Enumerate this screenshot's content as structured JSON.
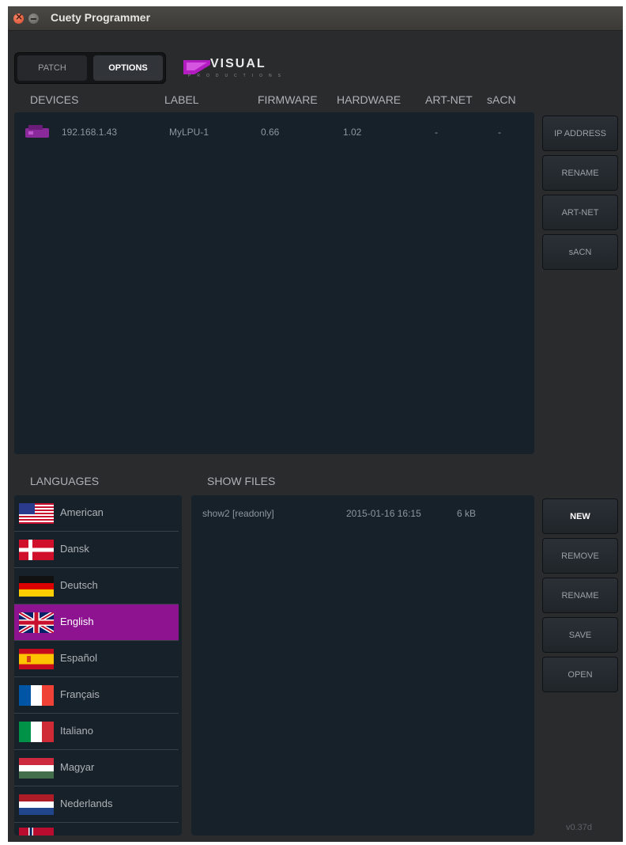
{
  "window": {
    "title": "Cuety Programmer"
  },
  "tabs": {
    "patch": "PATCH",
    "options": "OPTIONS"
  },
  "logo": {
    "word": "VISUAL",
    "sub": "PRODUCTIONS"
  },
  "devices": {
    "columns": [
      "DEVICES",
      "LABEL",
      "FIRMWARE",
      "HARDWARE",
      "ART-NET",
      "sACN"
    ],
    "rows": [
      {
        "device": "192.168.1.43",
        "label": "MyLPU-1",
        "firmware": "0.66",
        "hardware": "1.02",
        "artnet": "-",
        "sacn": "-"
      }
    ]
  },
  "device_actions": [
    "IP ADDRESS",
    "RENAME",
    "ART-NET",
    "sACN"
  ],
  "languages": {
    "header": "LANGUAGES",
    "items": [
      "American",
      "Dansk",
      "Deutsch",
      "English",
      "Español",
      "Français",
      "Italiano",
      "Magyar",
      "Nederlands"
    ],
    "selected": "English"
  },
  "showfiles": {
    "header": "SHOW FILES",
    "rows": [
      {
        "name": "show2 [readonly]",
        "date": "2015-01-16 16:15",
        "size": "6 kB"
      }
    ]
  },
  "show_actions": [
    "NEW",
    "REMOVE",
    "RENAME",
    "SAVE",
    "OPEN"
  ],
  "version": "v0.37d",
  "colors": {
    "selected": "#8d1390",
    "panel": "#17212a",
    "background": "#2a2b2d"
  }
}
